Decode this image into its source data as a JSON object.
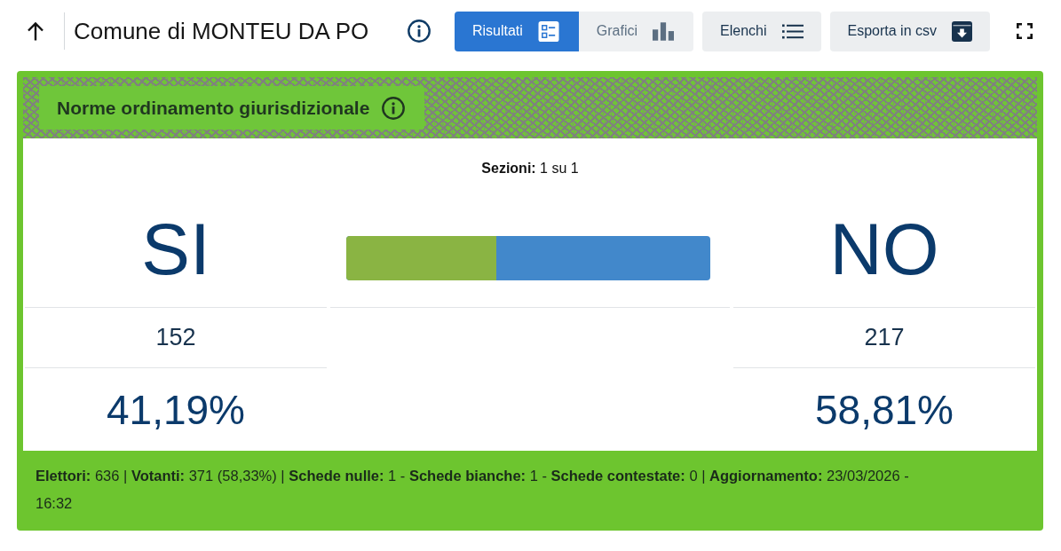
{
  "header": {
    "title": "Comune di MONTEU DA PO",
    "tabs": [
      {
        "label": "Risultati",
        "kind": "results",
        "selected": true
      },
      {
        "label": "Grafici",
        "kind": "charts",
        "selected": false
      }
    ],
    "buttons": [
      {
        "label": "Elenchi",
        "kind": "list"
      },
      {
        "label": "Esporta in csv",
        "kind": "export"
      }
    ]
  },
  "card": {
    "title": "Norme ordinamento giurisdizionale",
    "sections": "**Sezioni:** 1 su 1",
    "options": [
      {
        "label": "SI",
        "votes": "152",
        "percent": "41,19%",
        "color": "#8ab443"
      },
      {
        "label": "NO",
        "votes": "217",
        "percent": "58,81%",
        "color": "#4288cb"
      }
    ],
    "result_bar": {
      "level": 0.4119
    },
    "stats": "**Elettori:** 636 | **Votanti:** 371 (58,33%) | **Schede nulle:** 1 - **Schede bianche:** 1 - **Schede contestate:** 0 | **Aggiornamento:** 23/03/2026 - 16:32"
  }
}
